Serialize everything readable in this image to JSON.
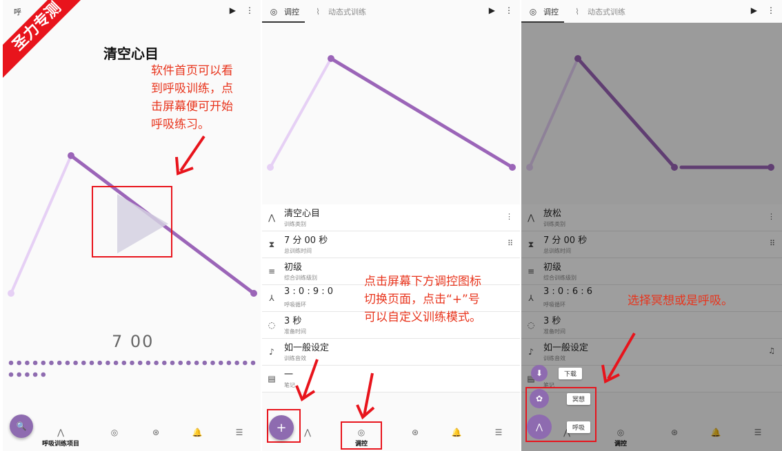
{
  "brand": {
    "banner": "圣力专测",
    "accent": "#8e6bb0",
    "light_line": "#e6d0f5",
    "annotation_red": "#e8341c"
  },
  "tabs": {
    "control": "调控",
    "dynamic": "动态式训练"
  },
  "panel1": {
    "tab_partial": "呼",
    "title": "清空心目",
    "timer": "7  00",
    "annotation": [
      "软件首页可以看",
      "到呼吸训练，点",
      "击屏幕便可开始",
      "呼吸练习。"
    ],
    "nav_label": "呼吸训练项目"
  },
  "panel2": {
    "rows": [
      {
        "icon": "lungs-icon",
        "glyph": "⋀",
        "main": "清空心目",
        "sub": "训练类别",
        "right": "⋮"
      },
      {
        "icon": "hourglass-icon",
        "glyph": "⧗",
        "main": "7 分 00 秒",
        "sub": "总训练时间",
        "right": "⠿"
      },
      {
        "icon": "level-icon",
        "glyph": "≡",
        "main": "初级",
        "sub": "综合训练级别",
        "right": ""
      },
      {
        "icon": "cycle-icon",
        "glyph": "⅄",
        "main": "3 : 0 : 9 : 0",
        "sub": "呼吸循环",
        "right": ""
      },
      {
        "icon": "loading-icon",
        "glyph": "◌",
        "main": "3 秒",
        "sub": "准备时间",
        "right": ""
      },
      {
        "icon": "music-note-icon",
        "glyph": "♪",
        "main": "如一般设定",
        "sub": "训练音效",
        "right": ""
      },
      {
        "icon": "note-icon",
        "glyph": "▤",
        "main": "一",
        "sub": "笔记",
        "right": ""
      }
    ],
    "annotation": [
      "点击屏幕下方调控图标",
      "切换页面，点击“+”号",
      "可以自定义训练模式。"
    ],
    "fab_label": "+",
    "nav_label": "调控"
  },
  "panel3": {
    "rows": [
      {
        "icon": "lungs-icon",
        "glyph": "⋀",
        "main": "放松",
        "sub": "训练类别",
        "right": "⋮"
      },
      {
        "icon": "hourglass-icon",
        "glyph": "⧗",
        "main": "7 分 00 秒",
        "sub": "总训练时间",
        "right": "⠿"
      },
      {
        "icon": "level-icon",
        "glyph": "≡",
        "main": "初级",
        "sub": "综合训练级别",
        "right": ""
      },
      {
        "icon": "cycle-icon",
        "glyph": "⅄",
        "main": "3 : 0 : 6 : 6",
        "sub": "呼吸循环",
        "right": ""
      },
      {
        "icon": "loading-icon",
        "glyph": "◌",
        "main": "3 秒",
        "sub": "准备时间",
        "right": ""
      },
      {
        "icon": "music-note-icon",
        "glyph": "♪",
        "main": "如一般设定",
        "sub": "训练音效",
        "right": "♫"
      },
      {
        "icon": "note-icon",
        "glyph": "▤",
        "main": "",
        "sub": "笔记",
        "right": ""
      }
    ],
    "annotation": "选择冥想或是呼吸。",
    "speed": {
      "download": "下载",
      "meditate": "冥想",
      "breathe": "呼吸"
    },
    "nav_label": "调控"
  }
}
